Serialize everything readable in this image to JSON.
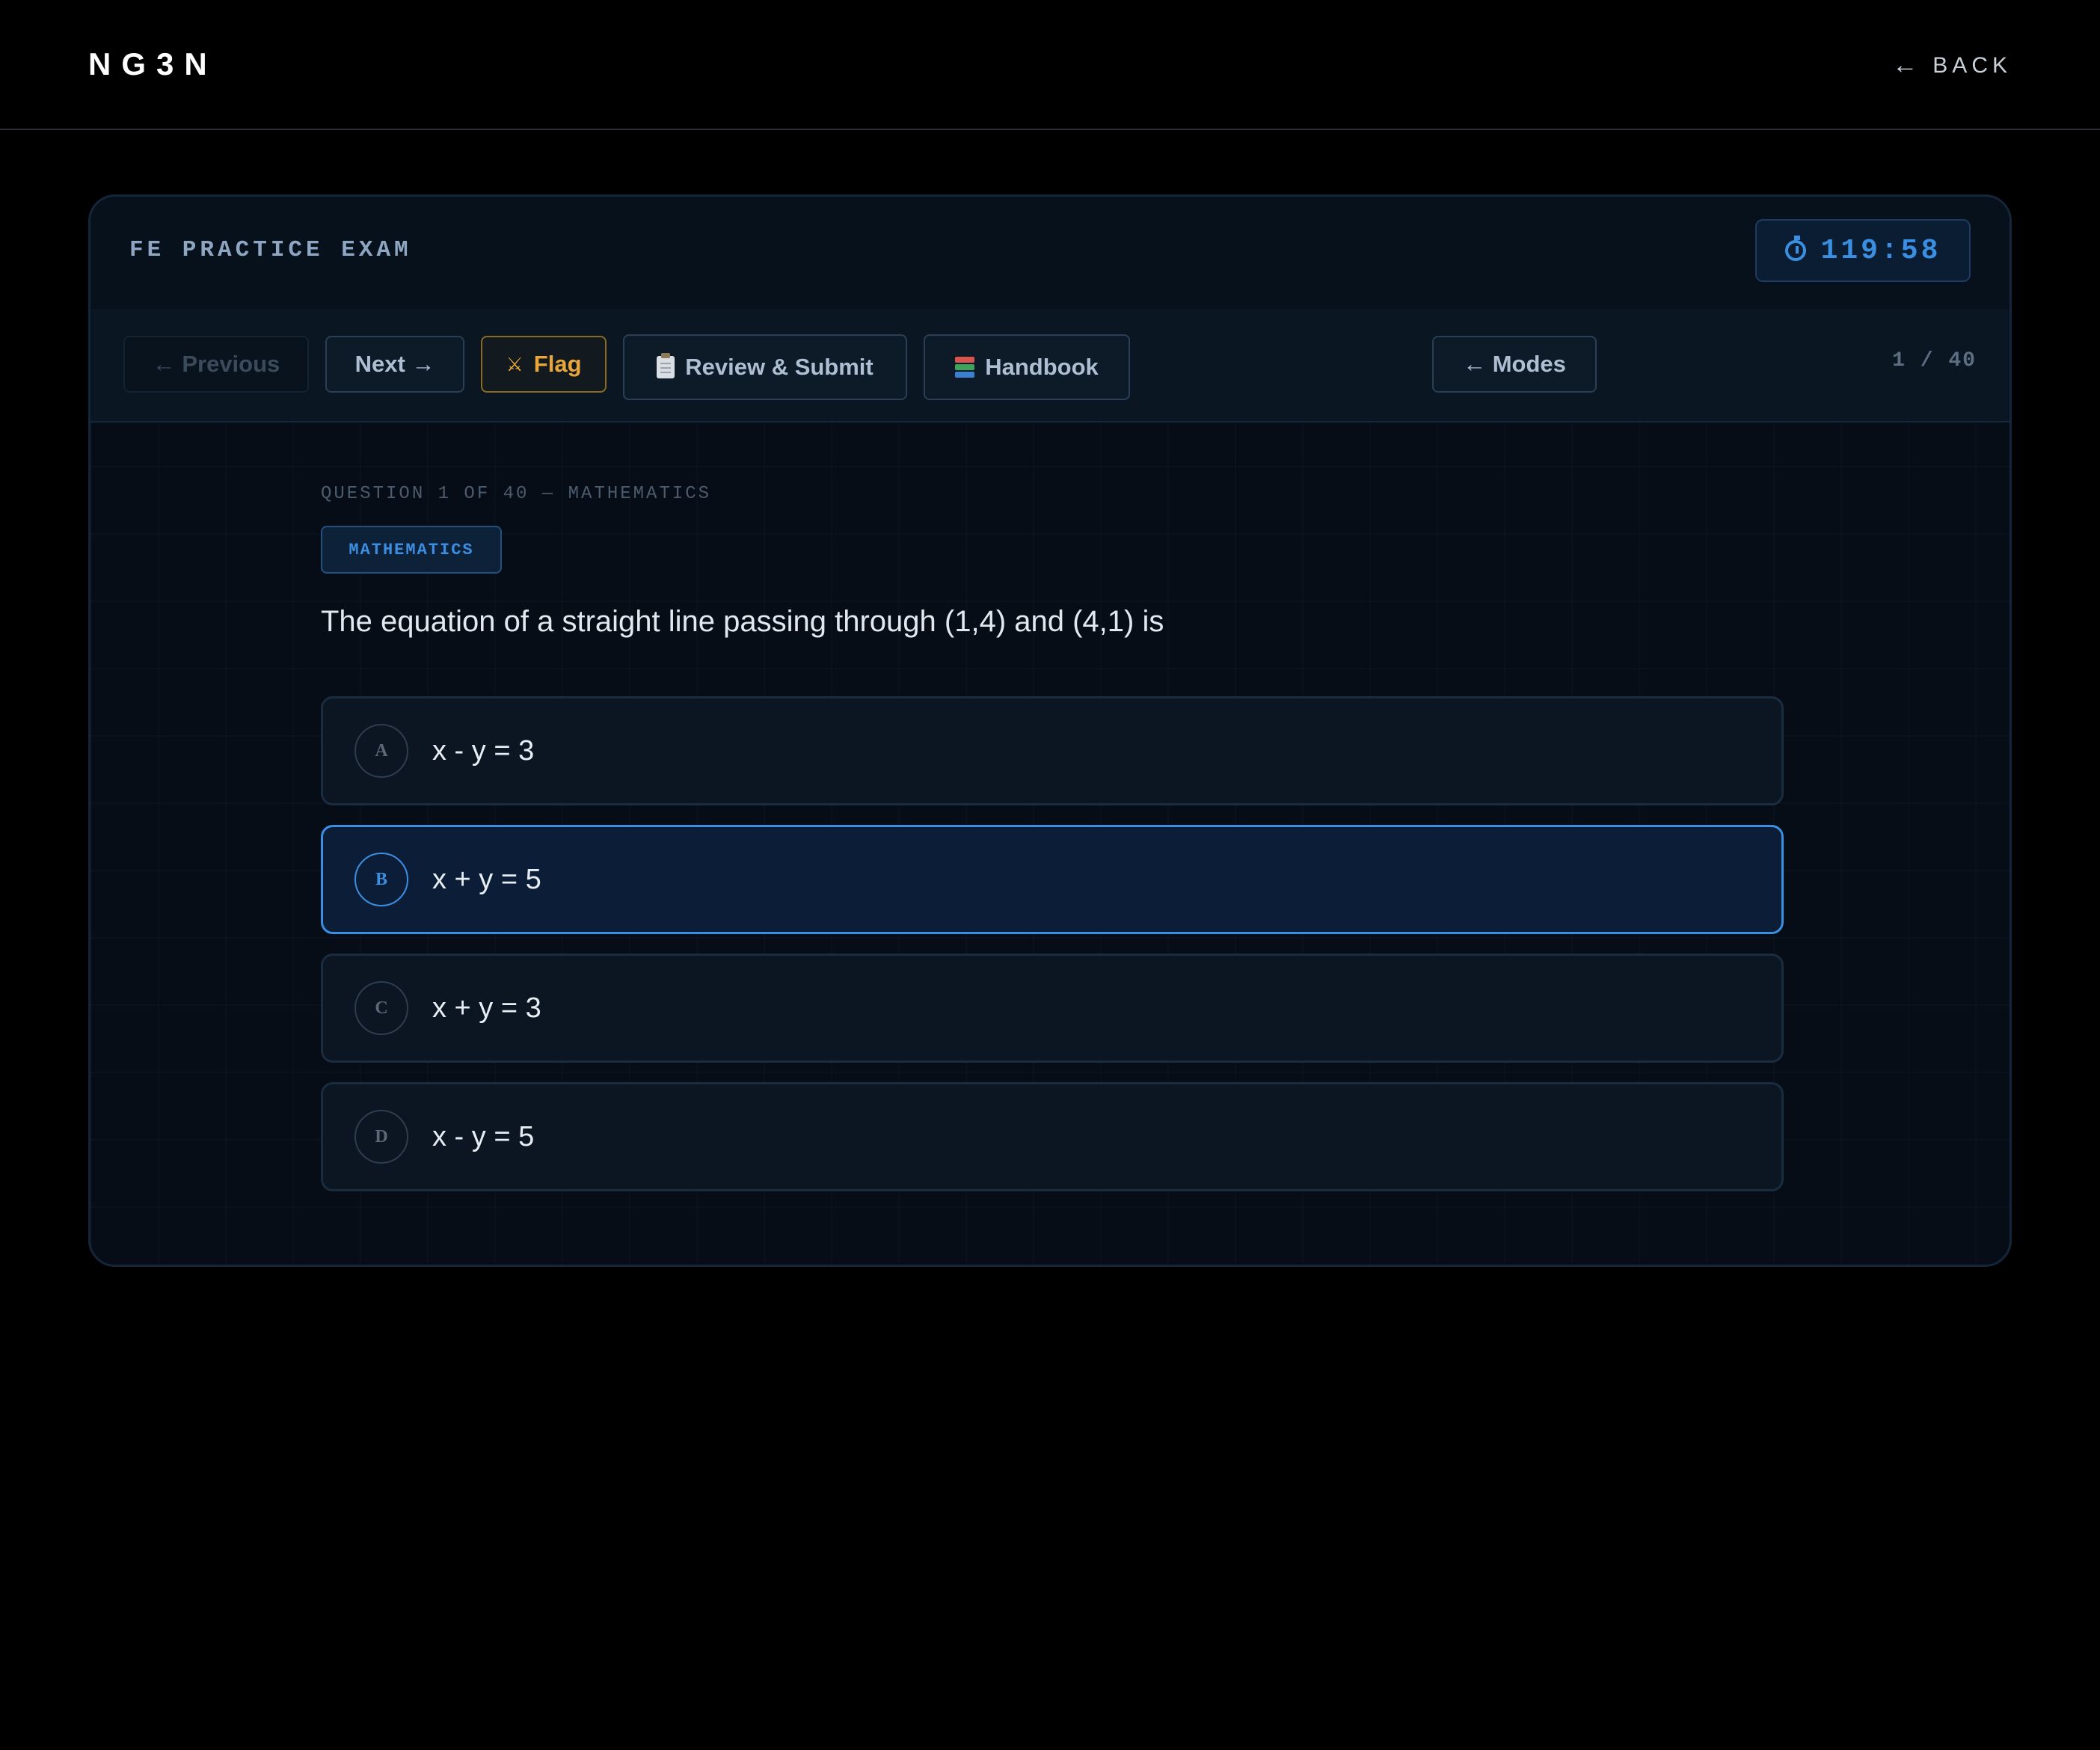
{
  "topbar": {
    "brand": "NG3N",
    "back_label": "BACK",
    "back_icon": "arrow-left-icon"
  },
  "card": {
    "title": "FE PRACTICE EXAM",
    "timer": {
      "icon": "stopwatch-icon",
      "value": "119:58"
    }
  },
  "toolbar": {
    "previous_label": "← Previous",
    "next_label": "Next →",
    "flag_label": "Flag",
    "review_label": "Review & Submit",
    "handbook_label": "Handbook",
    "modes_label": "← Modes",
    "counter": "1 / 40"
  },
  "question": {
    "meta": "QUESTION 1 OF 40 — MATHEMATICS",
    "tag": "MATHEMATICS",
    "text": "The equation of a straight line passing through (1,4) and (4,1) is",
    "options": [
      {
        "letter": "A",
        "text": "x - y = 3",
        "selected": false
      },
      {
        "letter": "B",
        "text": "x + y = 5",
        "selected": true
      },
      {
        "letter": "C",
        "text": "x + y = 3",
        "selected": false
      },
      {
        "letter": "D",
        "text": "x - y = 5",
        "selected": false
      }
    ]
  },
  "colors": {
    "accent": "#3b8fe3",
    "flag": "#e8a63a",
    "background": "#000000",
    "card": "#060d16"
  }
}
